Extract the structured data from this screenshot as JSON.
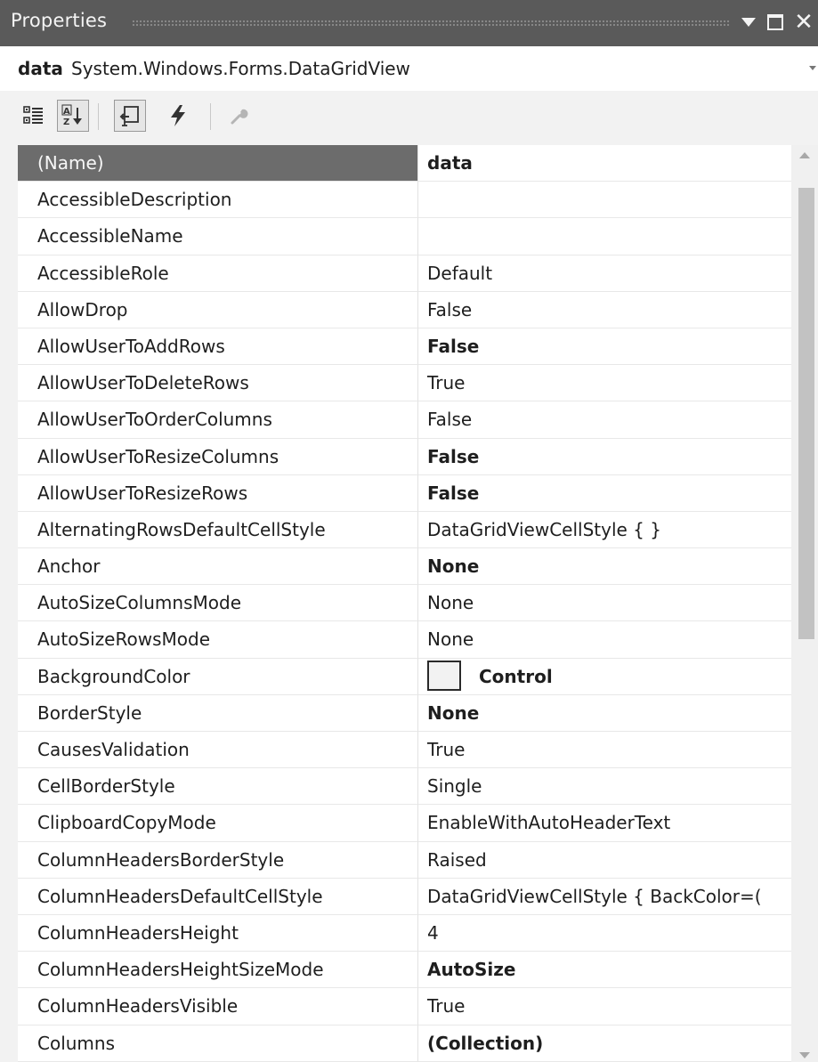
{
  "window": {
    "title": "Properties",
    "dropdown_icon": "triangle-down-icon",
    "maximize_icon": "maximize-icon",
    "close_icon": "close-icon",
    "close_glyph": "✕"
  },
  "object_selector": {
    "name": "data",
    "type": "System.Windows.Forms.DataGridView"
  },
  "toolbar": {
    "buttons": [
      "categorized-icon",
      "alphabetical-icon",
      "properties-icon",
      "events-icon",
      "property-pages-icon"
    ]
  },
  "properties": [
    {
      "name": "(Name)",
      "value": "data",
      "selected": true
    },
    {
      "name": "AccessibleDescription",
      "value": ""
    },
    {
      "name": "AccessibleName",
      "value": ""
    },
    {
      "name": "AccessibleRole",
      "value": "Default"
    },
    {
      "name": "AllowDrop",
      "value": "False"
    },
    {
      "name": "AllowUserToAddRows",
      "value": "False",
      "bold": true
    },
    {
      "name": "AllowUserToDeleteRows",
      "value": "True"
    },
    {
      "name": "AllowUserToOrderColumns",
      "value": "False"
    },
    {
      "name": "AllowUserToResizeColumns",
      "value": "False",
      "bold": true
    },
    {
      "name": "AllowUserToResizeRows",
      "value": "False",
      "bold": true
    },
    {
      "name": "AlternatingRowsDefaultCellStyle",
      "value": "DataGridViewCellStyle { }"
    },
    {
      "name": "Anchor",
      "value": "None",
      "bold": true
    },
    {
      "name": "AutoSizeColumnsMode",
      "value": "None"
    },
    {
      "name": "AutoSizeRowsMode",
      "value": "None"
    },
    {
      "name": "BackgroundColor",
      "value": "Control",
      "bold": true,
      "swatch": "#f2f2f2"
    },
    {
      "name": "BorderStyle",
      "value": "None",
      "bold": true
    },
    {
      "name": "CausesValidation",
      "value": "True"
    },
    {
      "name": "CellBorderStyle",
      "value": "Single"
    },
    {
      "name": "ClipboardCopyMode",
      "value": "EnableWithAutoHeaderText"
    },
    {
      "name": "ColumnHeadersBorderStyle",
      "value": "Raised"
    },
    {
      "name": "ColumnHeadersDefaultCellStyle",
      "value": "DataGridViewCellStyle { BackColor=("
    },
    {
      "name": "ColumnHeadersHeight",
      "value": "4"
    },
    {
      "name": "ColumnHeadersHeightSizeMode",
      "value": "AutoSize",
      "bold": true
    },
    {
      "name": "ColumnHeadersVisible",
      "value": "True"
    },
    {
      "name": "Columns",
      "value": "(Collection)",
      "bold": true
    }
  ],
  "colors": {
    "titlebar": "#5a5a5a",
    "selected_row": "#6c6c6c",
    "background": "#f2f2f2"
  }
}
